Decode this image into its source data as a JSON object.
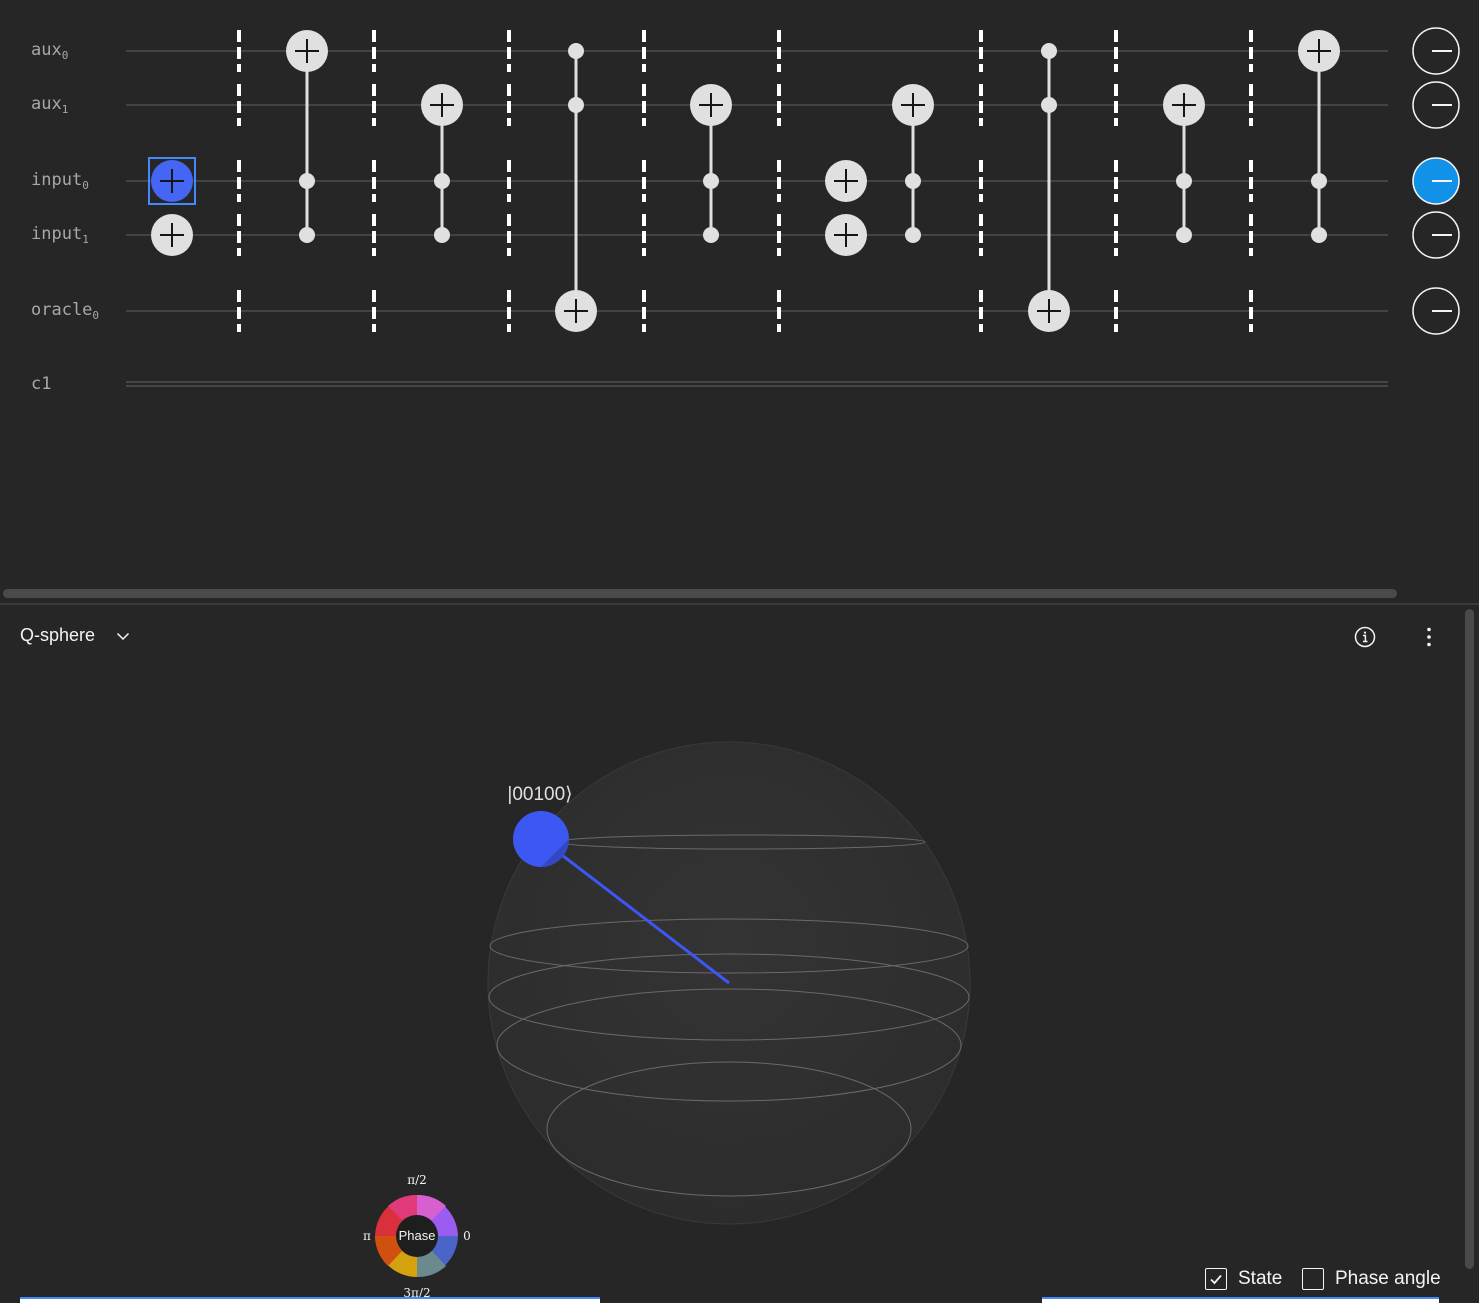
{
  "circuit": {
    "qubits": [
      {
        "base": "aux",
        "sub": "0"
      },
      {
        "base": "aux",
        "sub": "1"
      },
      {
        "base": "input",
        "sub": "0"
      },
      {
        "base": "input",
        "sub": "1"
      },
      {
        "base": "oracle",
        "sub": "0"
      }
    ],
    "classical_register": "c1",
    "gates": [
      {
        "type": "x",
        "target": 2,
        "selected": true
      },
      {
        "type": "x",
        "target": 3
      },
      {
        "type": "barrier"
      },
      {
        "type": "ccx",
        "controls": [
          2,
          3
        ],
        "target": 0
      },
      {
        "type": "barrier"
      },
      {
        "type": "ccx",
        "controls": [
          2,
          3
        ],
        "target": 1
      },
      {
        "type": "barrier"
      },
      {
        "type": "ccx",
        "controls": [
          0,
          1
        ],
        "target": 4
      },
      {
        "type": "barrier"
      },
      {
        "type": "ccx",
        "controls": [
          2,
          3
        ],
        "target": 1
      },
      {
        "type": "barrier"
      },
      {
        "type": "x",
        "target": 2
      },
      {
        "type": "x",
        "target": 3
      },
      {
        "type": "ccx",
        "controls": [
          2,
          3
        ],
        "target": 1
      },
      {
        "type": "barrier"
      },
      {
        "type": "ccx",
        "controls": [
          0,
          1
        ],
        "target": 4
      },
      {
        "type": "barrier"
      },
      {
        "type": "ccx",
        "controls": [
          2,
          3
        ],
        "target": 1
      },
      {
        "type": "barrier"
      },
      {
        "type": "ccx",
        "controls": [
          2,
          3
        ],
        "target": 0
      }
    ],
    "probability_indicators": [
      0,
      0,
      1,
      0,
      0
    ],
    "gate_color": "#e0e0e0",
    "selected_gate_color": "#4566f5",
    "probability_color": "#1192e8"
  },
  "visualization": {
    "title": "Q-sphere",
    "dropdown_icon": "chevron-down-icon",
    "info_icon": "information-icon",
    "menu_icon": "overflow-menu-vertical-icon",
    "state_label": "|00100⟩",
    "state_color": "#3d57f2",
    "phase_wheel": {
      "center_label": "Phase",
      "top": "π/2",
      "left": "π",
      "right": "0",
      "bottom": "3π/2"
    },
    "options": [
      {
        "label": "State",
        "checked": true
      },
      {
        "label": "Phase angle",
        "checked": false
      }
    ]
  }
}
